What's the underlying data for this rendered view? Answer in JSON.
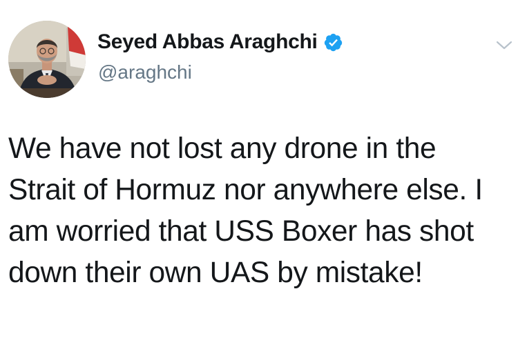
{
  "author": {
    "display_name": "Seyed Abbas Araghchi",
    "handle": "@araghchi",
    "verified": true,
    "avatar_icon": "profile-photo"
  },
  "tweet": {
    "text": "We have not lost any drone in the Strait of Hormuz nor anywhere else. I am worried that USS Boxer has shot down their own UAS by mistake!"
  },
  "menu": {
    "icon": "chevron-down-icon"
  },
  "colors": {
    "verified_badge": "#1da1f2",
    "text": "#14171a",
    "handle": "#657786",
    "chevron": "#ccd6dd"
  }
}
